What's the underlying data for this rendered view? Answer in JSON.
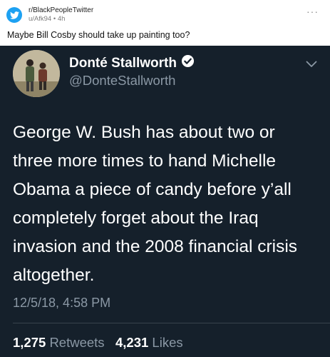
{
  "reddit": {
    "subreddit": "r/BlackPeopleTwitter",
    "meta": "u/Afk94 • 4h",
    "title": "Maybe Bill Cosby should take up painting too?",
    "more_label": "···",
    "icon": "twitter-bird-icon"
  },
  "tweet": {
    "display_name": "Donté Stallworth",
    "handle": "@DonteStallworth",
    "verified": true,
    "text": "George W. Bush has about two or three more times to hand Michelle Obama a piece of candy before y’all completely forget about the Iraq invasion and the 2008 financial crisis altogether.",
    "timestamp": "12/5/18, 4:58 PM",
    "retweets_count": "1,275",
    "retweets_label": "Retweets",
    "likes_count": "4,231",
    "likes_label": "Likes"
  },
  "colors": {
    "tweet_bg": "#15202b",
    "secondary_text": "#8b98a5",
    "twitter_blue": "#1da1f2"
  }
}
